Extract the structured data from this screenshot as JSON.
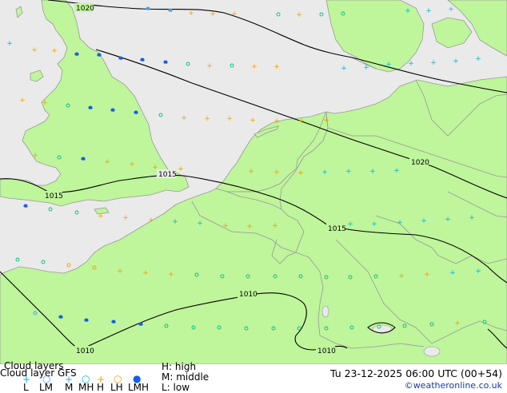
{
  "map": {
    "isobars": [
      {
        "label": "1020"
      },
      {
        "label": "1020"
      },
      {
        "label": "1015"
      },
      {
        "label": "1015"
      },
      {
        "label": "1015"
      },
      {
        "label": "1010"
      },
      {
        "label": "1010"
      },
      {
        "label": "1010"
      }
    ],
    "colors": {
      "land": "#bff59b",
      "sea": "#eaeaea",
      "border": "#999999",
      "isobar": "#000000",
      "low": "#00b8d8",
      "middle": "#4aa0e0",
      "high": "#f0a000",
      "lh_low": "#00c080",
      "lmh": "#1060e8"
    }
  },
  "legend": {
    "title": "Cloud layers",
    "model": "Cloud layer GFS",
    "symbols": [
      {
        "code": "L",
        "icon": "plus-icon",
        "color": "#00b8d8"
      },
      {
        "code": "LM",
        "icon": "circle-icon",
        "color": "#4aa0e0"
      },
      {
        "code": "M",
        "icon": "plus-icon",
        "color": "#4aa0e0"
      },
      {
        "code": "MH",
        "icon": "circle-icon",
        "color": "#00b8d8"
      },
      {
        "code": "H",
        "icon": "plus-icon",
        "color": "#f0a000"
      },
      {
        "code": "LH",
        "icon": "circle-icon",
        "color": "#f0a000"
      },
      {
        "code": "LMH",
        "icon": "filled-blob-icon",
        "color": "#1060e8"
      }
    ],
    "key_high": "H: high",
    "key_middle": "M: middle",
    "key_low": "L: low",
    "datetime": "Tu 23-12-2025 06:00 UTC (00+54)",
    "credit": "©weatheronline.co.uk"
  }
}
